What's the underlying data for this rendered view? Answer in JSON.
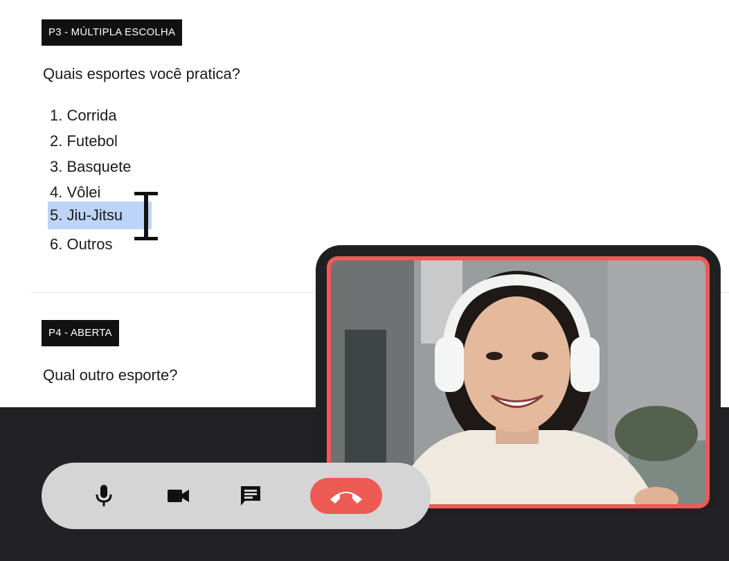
{
  "survey": {
    "question3": {
      "tag": "P3 - MÚLTIPLA ESCOLHA",
      "text": "Quais esportes você pratica?",
      "options": [
        "1. Corrida",
        "2. Futebol",
        "3. Basquete",
        "4. Vôlei",
        "5. Jiu-Jitsu",
        "6. Outros"
      ],
      "selected_index": 4
    },
    "question4": {
      "tag": "P4 - ABERTA",
      "text": "Qual outro esporte?"
    }
  },
  "call": {
    "controls": {
      "mic_icon": "mic-icon",
      "camera_icon": "videocam-icon",
      "chat_icon": "chat-icon",
      "hangup_icon": "phone-hangup-icon"
    },
    "colors": {
      "accent": "#ee5a54",
      "bar": "#222224",
      "controls_bg": "#d5d5d5",
      "selection": "#bcd4f7"
    }
  }
}
